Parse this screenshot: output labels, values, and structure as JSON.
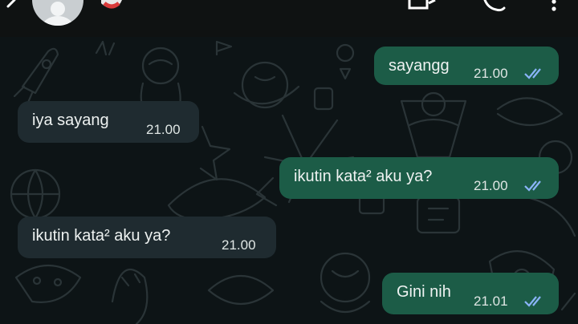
{
  "colors": {
    "header_bg": "#0f1212",
    "chat_bg": "#0d1416",
    "incoming_bubble": "#1f2b30",
    "outgoing_bubble": "#1c5c47",
    "read_receipt": "#8ab4f8",
    "doodle_stroke": "#2a3437"
  },
  "header": {
    "back_icon": "back-arrow-icon",
    "avatar_icon": "default-avatar-icon",
    "status_icon": "emoji-icon",
    "video_icon": "video-call-icon",
    "call_icon": "phone-icon",
    "menu_icon": "more-vertical-icon"
  },
  "messages": [
    {
      "direction": "out",
      "text": "sayangg",
      "time": "21.00",
      "status": "read"
    },
    {
      "direction": "in",
      "text": "iya sayang",
      "time": "21.00"
    },
    {
      "direction": "out",
      "text": "ikutin kata² aku ya?",
      "time": "21.00",
      "status": "read"
    },
    {
      "direction": "in",
      "text": "ikutin kata² aku ya?",
      "time": "21.00"
    },
    {
      "direction": "out",
      "text": "Gini nih",
      "time": "21.01",
      "status": "read"
    }
  ]
}
